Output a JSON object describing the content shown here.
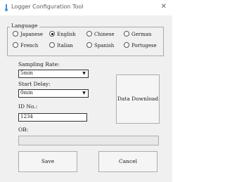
{
  "window": {
    "title": "Logger Configuration Tool",
    "close_glyph": "✕"
  },
  "language": {
    "legend": "Language",
    "options": [
      {
        "label": "Japanese",
        "selected": false
      },
      {
        "label": "English",
        "selected": true
      },
      {
        "label": "Chinese",
        "selected": false
      },
      {
        "label": "German",
        "selected": false
      },
      {
        "label": "French",
        "selected": false
      },
      {
        "label": "Italian",
        "selected": false
      },
      {
        "label": "Spanish",
        "selected": false
      },
      {
        "label": "Portugese",
        "selected": false
      }
    ]
  },
  "sampling_rate": {
    "label": "Sampling Rate:",
    "value": "5min"
  },
  "start_delay": {
    "label": "Start Delay:",
    "value": "0min"
  },
  "id_no": {
    "label": "ID No.:",
    "value": "1234"
  },
  "path": {
    "label": "OB:",
    "value": ""
  },
  "buttons": {
    "download": "Data Download",
    "save": "Save",
    "cancel": "Cancel"
  },
  "colors": {
    "window_bg": "#f0f0f0",
    "accent_icon": "#4a90d9"
  }
}
